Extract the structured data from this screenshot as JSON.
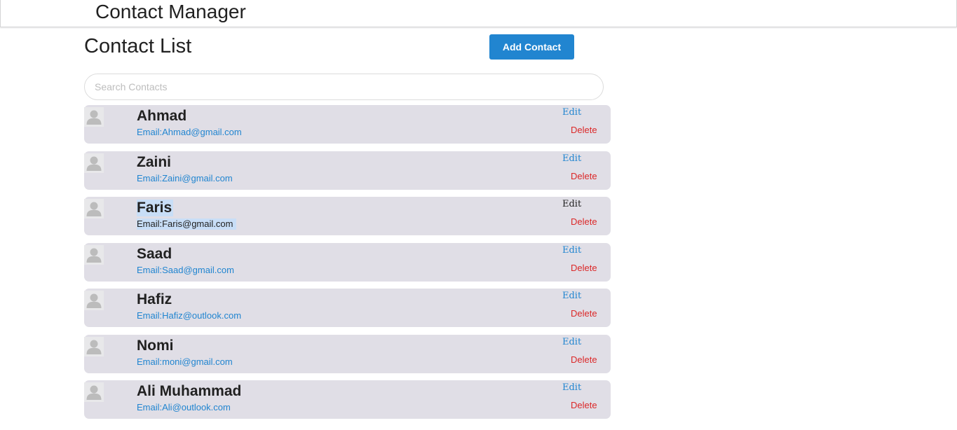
{
  "header": {
    "title": "Contact Manager"
  },
  "main": {
    "title": "Contact List",
    "add_button_label": "Add Contact",
    "search": {
      "placeholder": "Search Contacts",
      "value": ""
    }
  },
  "contacts": [
    {
      "name": "Ahmad",
      "email": "Email:Ahmad@gmail.com",
      "edit_label": "Edit",
      "delete_label": "Delete",
      "avatar_icon": "user-avatar-icon",
      "selected": false
    },
    {
      "name": "Zaini",
      "email": "Email:Zaini@gmail.com",
      "edit_label": "Edit",
      "delete_label": "Delete",
      "avatar_icon": "user-avatar-icon",
      "selected": false
    },
    {
      "name": "Faris",
      "email": "Email:Faris@gmail.com",
      "edit_label": "Edit",
      "delete_label": "Delete",
      "avatar_icon": "user-avatar-icon",
      "selected": true
    },
    {
      "name": "Saad",
      "email": "Email:Saad@gmail.com",
      "edit_label": "Edit",
      "delete_label": "Delete",
      "avatar_icon": "user-avatar-icon",
      "selected": false
    },
    {
      "name": "Hafiz",
      "email": "Email:Hafiz@outlook.com",
      "edit_label": "Edit",
      "delete_label": "Delete",
      "avatar_icon": "user-avatar-icon",
      "selected": false
    },
    {
      "name": "Nomi",
      "email": "Email:moni@gmail.com",
      "edit_label": "Edit",
      "delete_label": "Delete",
      "avatar_icon": "user-avatar-icon",
      "selected": false
    },
    {
      "name": "Ali Muhammad",
      "email": "Email:Ali@outlook.com",
      "edit_label": "Edit",
      "delete_label": "Delete",
      "avatar_icon": "user-avatar-icon",
      "selected": false
    }
  ],
  "colors": {
    "primary": "#2185d0",
    "danger": "#db2828",
    "card_background": "#e0dee6",
    "selection_highlight": "#c8def7"
  }
}
